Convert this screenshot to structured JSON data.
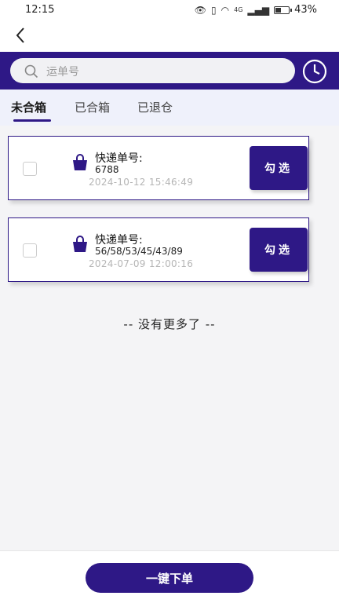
{
  "status_bar": {
    "time": "12:15",
    "battery": "43%",
    "network": "4G"
  },
  "search": {
    "placeholder": "运单号"
  },
  "tabs": [
    {
      "label": "未合箱",
      "active": true
    },
    {
      "label": "已合箱",
      "active": false
    },
    {
      "label": "已退仓",
      "active": false
    }
  ],
  "orders": [
    {
      "label": "快递单号:",
      "number": "6788",
      "date": "2024-10-12 15:46:49",
      "button": "勾选"
    },
    {
      "label": "快递单号:",
      "number": "56/58/53/45/43/89",
      "date": "2024-07-09 12:00:16",
      "button": "勾选"
    }
  ],
  "no_more_text": "-- 没有更多了 --",
  "bottom": {
    "submit_label": "一键下单"
  },
  "colors": {
    "accent": "#2e1886",
    "background": "#f4f4f6"
  },
  "icons": [
    "back-icon",
    "search-icon",
    "history-clock-icon",
    "shopping-bag-icon",
    "wifi-icon",
    "battery-icon"
  ]
}
